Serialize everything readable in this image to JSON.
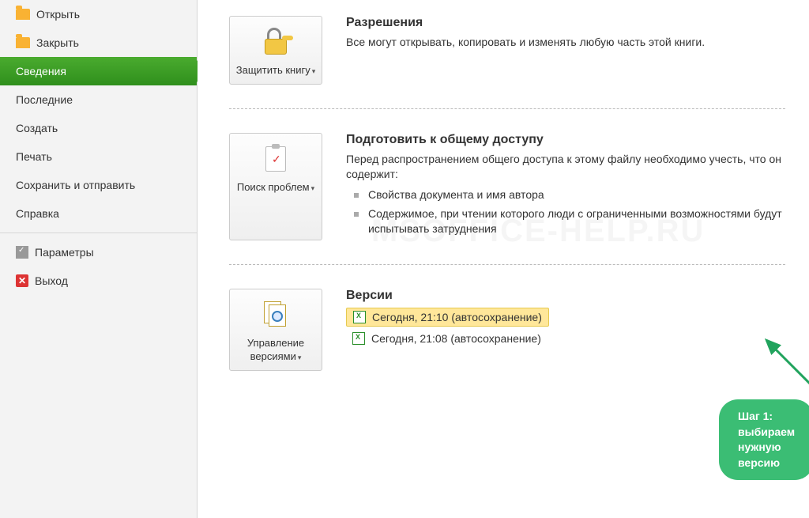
{
  "sidebar": {
    "items": [
      {
        "label": "Открыть",
        "icon": "folder-open-icon"
      },
      {
        "label": "Закрыть",
        "icon": "folder-closed-icon"
      },
      {
        "label": "Сведения",
        "selected": true
      },
      {
        "label": "Последние"
      },
      {
        "label": "Создать"
      },
      {
        "label": "Печать"
      },
      {
        "label": "Сохранить и отправить"
      },
      {
        "label": "Справка"
      },
      {
        "label": "Параметры",
        "icon": "settings-icon"
      },
      {
        "label": "Выход",
        "icon": "exit-icon"
      }
    ]
  },
  "permissions": {
    "button_label": "Защитить книгу",
    "title": "Разрешения",
    "desc": "Все могут открывать, копировать и изменять любую часть этой книги."
  },
  "prepare": {
    "button_label": "Поиск проблем",
    "title": "Подготовить к общему доступу",
    "desc": "Перед распространением общего доступа к этому файлу необходимо учесть, что он содержит:",
    "bullets": [
      "Свойства документа и имя автора",
      "Содержимое, при чтении которого люди с ограниченными возможностями будут испытывать затруднения"
    ]
  },
  "versions": {
    "button_label": "Управление версиями",
    "title": "Версии",
    "items": [
      {
        "label": "Сегодня, 21:10 (автосохранение)",
        "highlighted": true
      },
      {
        "label": "Сегодня, 21:08 (автосохранение)",
        "highlighted": false
      }
    ]
  },
  "callout": {
    "line1": "Шаг 1:",
    "line2": "выбираем нужную версию"
  },
  "watermark": "MSOFFICE-HELP.RU"
}
